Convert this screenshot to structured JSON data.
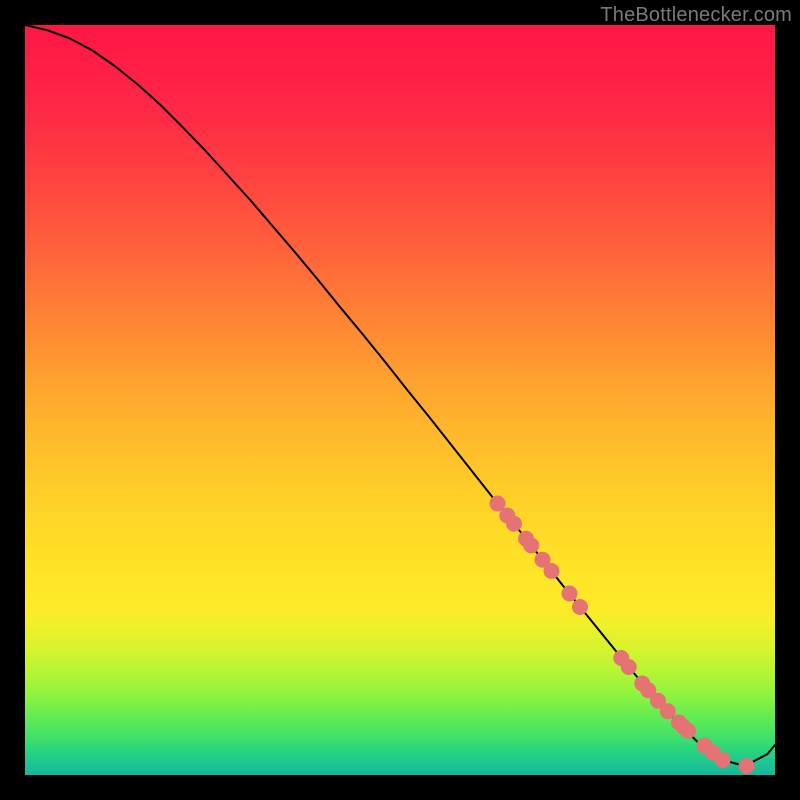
{
  "attribution": "TheBottlenecker.com",
  "chart_data": {
    "type": "line",
    "title": "",
    "xlabel": "",
    "ylabel": "",
    "xlim": [
      0,
      100
    ],
    "ylim": [
      0,
      100
    ],
    "x": [
      0,
      3,
      6,
      9,
      12,
      15,
      18,
      21,
      24,
      27,
      30,
      33,
      36,
      39,
      42,
      45,
      48,
      51,
      54,
      57,
      60,
      63,
      66,
      69,
      72,
      75,
      78,
      81,
      84,
      87,
      90,
      93,
      96,
      99,
      100
    ],
    "y": [
      100,
      99.3,
      98.2,
      96.6,
      94.5,
      92.1,
      89.4,
      86.4,
      83.3,
      80.0,
      76.7,
      73.2,
      69.7,
      66.1,
      62.4,
      58.8,
      55.1,
      51.3,
      47.6,
      43.8,
      40.0,
      36.2,
      32.5,
      28.7,
      24.9,
      21.2,
      17.5,
      13.8,
      10.3,
      7.0,
      4.1,
      2.0,
      1.2,
      2.8,
      4.0
    ],
    "markers_x": [
      63,
      64.3,
      65.2,
      66.8,
      67.5,
      69.0,
      70.2,
      72.6,
      74.0,
      79.5,
      80.5,
      82.3,
      83.1,
      84.4,
      85.7,
      87.2,
      87.8,
      88.4,
      90.6,
      91.7,
      93.0,
      96.2
    ],
    "markers_y": [
      36.2,
      34.6,
      33.5,
      31.5,
      30.6,
      28.7,
      27.2,
      24.2,
      22.4,
      15.6,
      14.4,
      12.2,
      11.3,
      9.9,
      8.5,
      7.0,
      6.4,
      5.9,
      3.9,
      3.0,
      2.0,
      1.2
    ],
    "marker_color": "#e57373",
    "marker_radius": 8,
    "line_color": "#000000",
    "line_width": 2,
    "gradient_stops": [
      {
        "offset": 0.0,
        "color": "#ff1744"
      },
      {
        "offset": 0.06,
        "color": "#ff1f46"
      },
      {
        "offset": 0.12,
        "color": "#ff2a45"
      },
      {
        "offset": 0.18,
        "color": "#ff3b42"
      },
      {
        "offset": 0.24,
        "color": "#ff4e3f"
      },
      {
        "offset": 0.3,
        "color": "#ff623b"
      },
      {
        "offset": 0.36,
        "color": "#ff7837"
      },
      {
        "offset": 0.42,
        "color": "#ff8e33"
      },
      {
        "offset": 0.48,
        "color": "#ffa32f"
      },
      {
        "offset": 0.54,
        "color": "#ffb72c"
      },
      {
        "offset": 0.6,
        "color": "#ffc829"
      },
      {
        "offset": 0.66,
        "color": "#ffd727"
      },
      {
        "offset": 0.72,
        "color": "#ffe227"
      },
      {
        "offset": 0.775,
        "color": "#ffea28"
      },
      {
        "offset": 0.805,
        "color": "#ecf02a"
      },
      {
        "offset": 0.835,
        "color": "#d3f42e"
      },
      {
        "offset": 0.865,
        "color": "#b2f535"
      },
      {
        "offset": 0.895,
        "color": "#8cf340"
      },
      {
        "offset": 0.92,
        "color": "#66ed50"
      },
      {
        "offset": 0.945,
        "color": "#45e364"
      },
      {
        "offset": 0.965,
        "color": "#2cd67b"
      },
      {
        "offset": 0.982,
        "color": "#1dc790"
      },
      {
        "offset": 1.0,
        "color": "#18b89e"
      }
    ]
  }
}
